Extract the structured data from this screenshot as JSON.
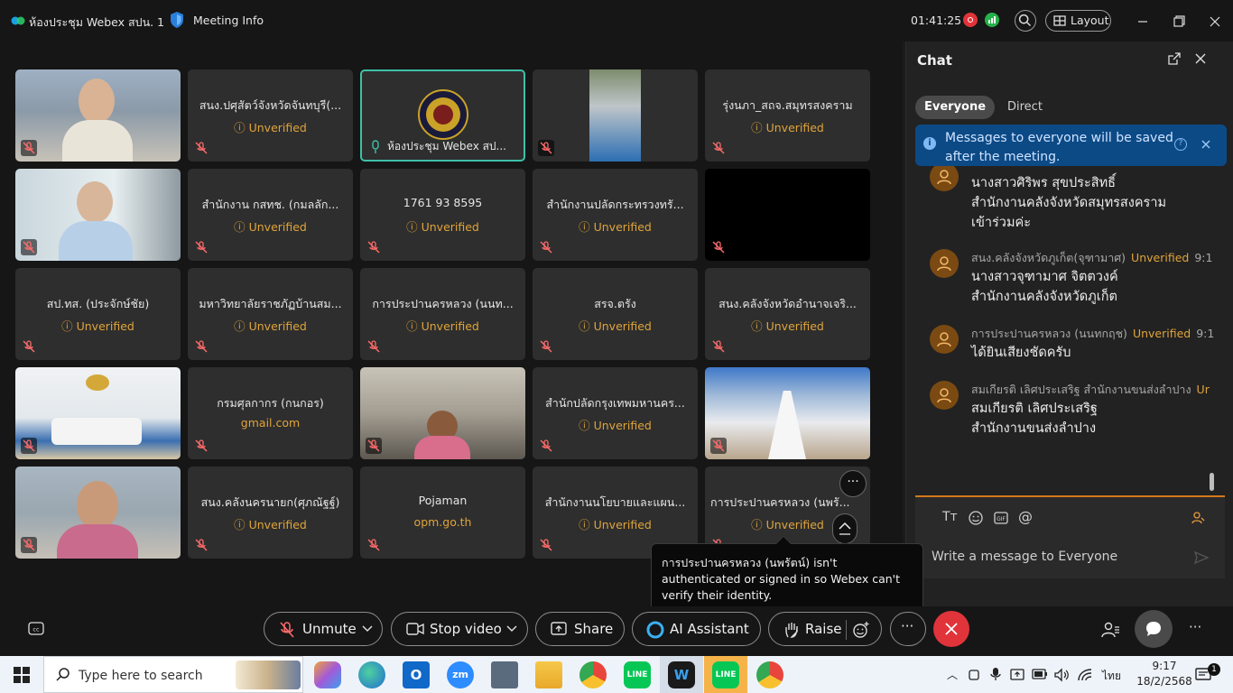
{
  "titlebar": {
    "app_title": "ห้องประชุม Webex สปน. 1",
    "meeting_info": "Meeting Info",
    "clock": "01:41:25",
    "layout_label": "Layout"
  },
  "tiles": [
    {
      "kind": "video",
      "name": "",
      "sub": ""
    },
    {
      "kind": "name",
      "name": "สนง.ปศุสัตว์จังหวัดจันทบุรี(...",
      "sub": "Unverified"
    },
    {
      "kind": "logo",
      "name": "",
      "sub": "",
      "caption": "ห้องประชุม Webex สป..."
    },
    {
      "kind": "video",
      "name": "",
      "sub": ""
    },
    {
      "kind": "name",
      "name": "รุ่งนภา_สถจ.สมุทรสงคราม",
      "sub": "Unverified"
    },
    {
      "kind": "video",
      "name": "",
      "sub": ""
    },
    {
      "kind": "name",
      "name": "สำนักงาน กสทช. (กมลลัก...",
      "sub": "Unverified"
    },
    {
      "kind": "name",
      "name": "1761 93 8595",
      "sub": "Unverified"
    },
    {
      "kind": "name",
      "name": "สำนักงานปลัดกระทรวงทรั...",
      "sub": "Unverified"
    },
    {
      "kind": "black",
      "name": "",
      "sub": ""
    },
    {
      "kind": "name",
      "name": "สป.ทส. (ประจักษ์ชัย)",
      "sub": "Unverified"
    },
    {
      "kind": "name",
      "name": "มหาวิทยาลัยราชภัฏบ้านสม...",
      "sub": "Unverified"
    },
    {
      "kind": "name",
      "name": "การประปานครหลวง (นนท...",
      "sub": "Unverified"
    },
    {
      "kind": "name",
      "name": "สรจ.ตรัง",
      "sub": "Unverified"
    },
    {
      "kind": "name",
      "name": "สนง.คลังจังหวัดอำนาจเจริ...",
      "sub": "Unverified"
    },
    {
      "kind": "video",
      "name": "",
      "sub": ""
    },
    {
      "kind": "name",
      "name": "กรมศุลกากร (กนกอร)",
      "sub": "gmail.com"
    },
    {
      "kind": "video",
      "name": "",
      "sub": ""
    },
    {
      "kind": "name",
      "name": "สำนักปลัดกรุงเทพมหานคร...",
      "sub": "Unverified"
    },
    {
      "kind": "video",
      "name": "",
      "sub": ""
    },
    {
      "kind": "video",
      "name": "",
      "sub": ""
    },
    {
      "kind": "name",
      "name": "สนง.คลังนครนายก(ศุภณัฐฐ์)",
      "sub": "Unverified"
    },
    {
      "kind": "name",
      "name": "Pojaman",
      "sub": "opm.go.th"
    },
    {
      "kind": "name",
      "name": "สำนักงานนโยบายและแผน...",
      "sub": "Unverified"
    },
    {
      "kind": "name",
      "name": "การประปานครหลวง (นพรั...",
      "sub": "Unverified"
    }
  ],
  "chat": {
    "title": "Chat",
    "tabs": [
      "Everyone",
      "Direct"
    ],
    "banner": "Messages to everyone will be saved after the meeting.",
    "messages": [
      {
        "sender": "",
        "status": "",
        "time": "",
        "text": "นางสาวศิริพร สุขประสิทธิ์\nสำนักงานคลังจังหวัดสมุทรสงคราม\nเข้าร่วมค่ะ"
      },
      {
        "sender": "สนง.คลังจังหวัดภูเก็ต(จุฑามาศ)",
        "status": "Unverified",
        "time": "9:1",
        "text": "นางสาวจุฑามาศ จิตตวงค์\nสำนักงานคลังจังหวัดภูเก็ต"
      },
      {
        "sender": "การประปานครหลวง (นนทกฤช)",
        "status": "Unverified",
        "time": "9:1",
        "text": "ได้ยินเสียงชัดครับ"
      },
      {
        "sender": "สมเกียรติ เลิศประเสริฐ สำนักงานขนส่งลำปาง",
        "status": "Ur",
        "time": "",
        "text": "สมเกียรติ เลิศประเสริฐ\nสำนักงานขนส่งลำปาง"
      }
    ],
    "composer_placeholder": "Write a message to Everyone"
  },
  "tooltip": "การประปานครหลวง (นพรัตน์) isn't authenticated or signed in so Webex can't verify their identity.",
  "controls": {
    "unmute": "Unmute",
    "stop_video": "Stop video",
    "share": "Share",
    "ai_assistant": "AI Assistant",
    "raise": "Raise"
  },
  "taskbar": {
    "search_placeholder": "Type here to search",
    "language": "ไทย",
    "time": "9:17",
    "date": "18/2/2568"
  },
  "colors": {
    "accent_orange": "#e0a43a",
    "end_call_red": "#e0343a",
    "banner_blue": "#0c4a86",
    "active_tile_border": "#3ec1a8"
  }
}
